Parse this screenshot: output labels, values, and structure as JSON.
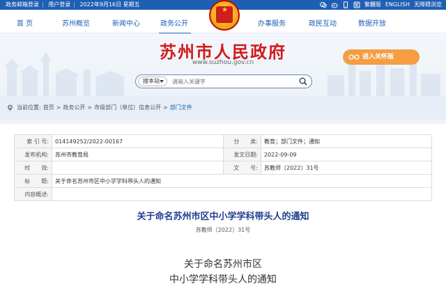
{
  "topbar": {
    "left": [
      "政务邮箱登录",
      "用户登录",
      "2022年9月16日 星期五"
    ],
    "right": [
      "繁體版",
      "ENGLISH",
      "无障碍浏览"
    ]
  },
  "nav": {
    "items": [
      "首 页",
      "苏州概览",
      "新闻中心",
      "政务公开",
      "办事服务",
      "政民互动",
      "数据开放"
    ]
  },
  "site": {
    "title": "苏州市人民政府",
    "url": "www.suzhou.gov.cn",
    "care_mode": "进入关怀版"
  },
  "search": {
    "scope": "搜本站",
    "placeholder": "请输入关键字"
  },
  "breadcrumb": {
    "prefix": "当前位置:",
    "items": [
      "首页",
      "政务公开",
      "市级部门（单位）信息公开",
      "部门文件"
    ]
  },
  "meta": {
    "rows": [
      {
        "k1": "索 引 号:",
        "v1": "014149252/2022-00167",
        "k2": "分　　类:",
        "v2": "教育；部门文件；通知"
      },
      {
        "k1": "发布机构:",
        "v1": "苏州市教育局",
        "k2": "发文日期:",
        "v2": "2022-09-09"
      },
      {
        "k1": "时　　效:",
        "v1": "",
        "k2": "文　　号:",
        "v2": "苏教师〔2022〕31号"
      }
    ],
    "title_label": "标　　题:",
    "title_value": "关于命名苏州市区中小学学科带头人的通知",
    "summary_label": "内容概述:",
    "summary_value": ""
  },
  "document": {
    "title": "关于命名苏州市区中小学学科带头人的通知",
    "number": "苏教师〔2022〕31号",
    "body_title_line1": "关于命名苏州市区",
    "body_title_line2": "中小学学科带头人的通知"
  },
  "colors": {
    "brand_blue": "#1f5fb3",
    "title_red": "#d3191a",
    "care_orange": "#f49d41",
    "doc_title_blue": "#1f3f8f"
  }
}
